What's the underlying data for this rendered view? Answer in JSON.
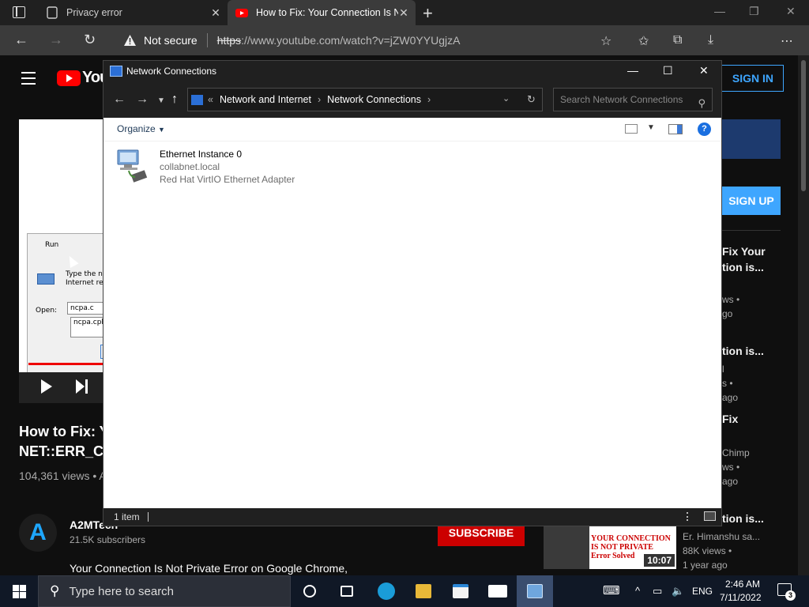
{
  "browser": {
    "tabs": [
      {
        "title": "Privacy error",
        "active": false
      },
      {
        "title": "How to Fix: Your Connection Is N",
        "active": true
      }
    ],
    "security_label": "Not secure",
    "url_scheme": "https",
    "url_rest": "://www.youtube.com/watch?v=jZW0YYUgjzA"
  },
  "youtube": {
    "logo_text": "You",
    "signin_label": "SIGN IN",
    "run_dialog": {
      "title": "Run",
      "type_text": "Type the na Internet res",
      "open_label": "Open:",
      "input_value": "ncpa.c",
      "suggestion": "ncpa.cpl"
    },
    "video_title": "How to Fix: Yo NET::ERR_CE",
    "video_title_line1": "How to Fix: Yo",
    "video_title_line2": "NET::ERR_CE",
    "views": "104,361 views • A",
    "channel": {
      "name": "A2MTech",
      "subscribers": "21.5K subscribers",
      "avatar_text": "A"
    },
    "subscribe_label": "SUBSCRIBE",
    "description": "Your Connection Is Not Private Error on Google Chrome,",
    "signup_label": "SIGN UP",
    "related": [
      {
        "title1": "Fix Your",
        "title2": "tion is...",
        "meta1": "ws •",
        "meta2": "go"
      },
      {
        "title1": "tion is...",
        "meta1": "l",
        "meta2": "s •",
        "meta3": "ago"
      },
      {
        "title1": "Fix",
        "meta1": "Chimp",
        "meta2": "ws •",
        "meta3": "ago"
      },
      {
        "title1": "tion is...",
        "author": "Er. Himanshu sa...",
        "views": "88K views •",
        "age": "1 year ago",
        "thumb_text": "YOUR CONNECTION IS NOT PRIVATE Error Solved",
        "duration": "10:07"
      }
    ]
  },
  "window": {
    "title": "Network Connections",
    "breadcrumb": [
      "Network and Internet",
      "Network Connections"
    ],
    "search_placeholder": "Search Network Connections",
    "organize_label": "Organize",
    "items": [
      {
        "name": "Ethernet Instance 0",
        "domain": "collabnet.local",
        "adapter": "Red Hat VirtIO Ethernet Adapter"
      }
    ],
    "status": "1 item"
  },
  "taskbar": {
    "search_placeholder": "Type here to search",
    "language": "ENG",
    "time": "2:46 AM",
    "date": "7/11/2022",
    "notification_count": "3"
  },
  "colors": {
    "youtube_red": "#ff0000",
    "youtube_blue": "#3ea6ff",
    "subscribe_red": "#cc0000",
    "explorer_dark": "#202020",
    "taskbar": "#101826"
  }
}
